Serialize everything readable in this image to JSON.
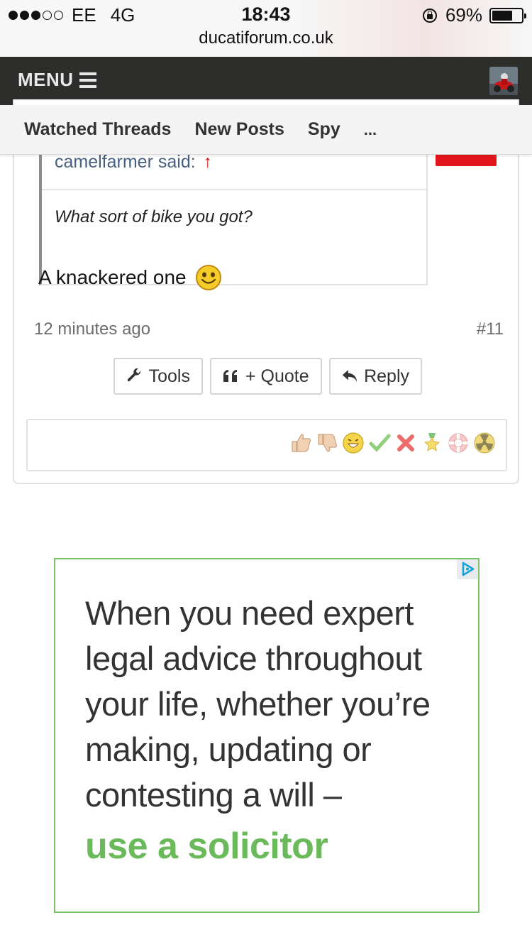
{
  "status_bar": {
    "carrier": "EE",
    "network": "4G",
    "time": "18:43",
    "battery_percent": "69%",
    "battery_level": 0.69,
    "url": "ducatiforum.co.uk"
  },
  "nav": {
    "menu_label": "MENU"
  },
  "tabs": [
    {
      "label": "Watched Threads"
    },
    {
      "label": "New Posts"
    },
    {
      "label": "Spy"
    },
    {
      "label": "..."
    }
  ],
  "post": {
    "quote": {
      "author_said": "camelfarmer said:",
      "arrow": "↑",
      "text": "What sort of bike you got?"
    },
    "body": "A knackered one",
    "time": "12 minutes ago",
    "number": "#11",
    "actions": {
      "tools": "Tools",
      "quote": "+ Quote",
      "reply": "Reply"
    },
    "ratings": [
      {
        "name": "like-icon"
      },
      {
        "name": "dislike-icon"
      },
      {
        "name": "funny-icon"
      },
      {
        "name": "agree-icon"
      },
      {
        "name": "disagree-icon"
      },
      {
        "name": "winner-icon"
      },
      {
        "name": "informative-icon"
      },
      {
        "name": "dumb-icon"
      }
    ]
  },
  "ad": {
    "text": "When you need expert legal advice throughout your life, whether you’re making, updating or contesting a will –",
    "cta": "use a solicitor",
    "accent_color": "#6ab95a"
  }
}
